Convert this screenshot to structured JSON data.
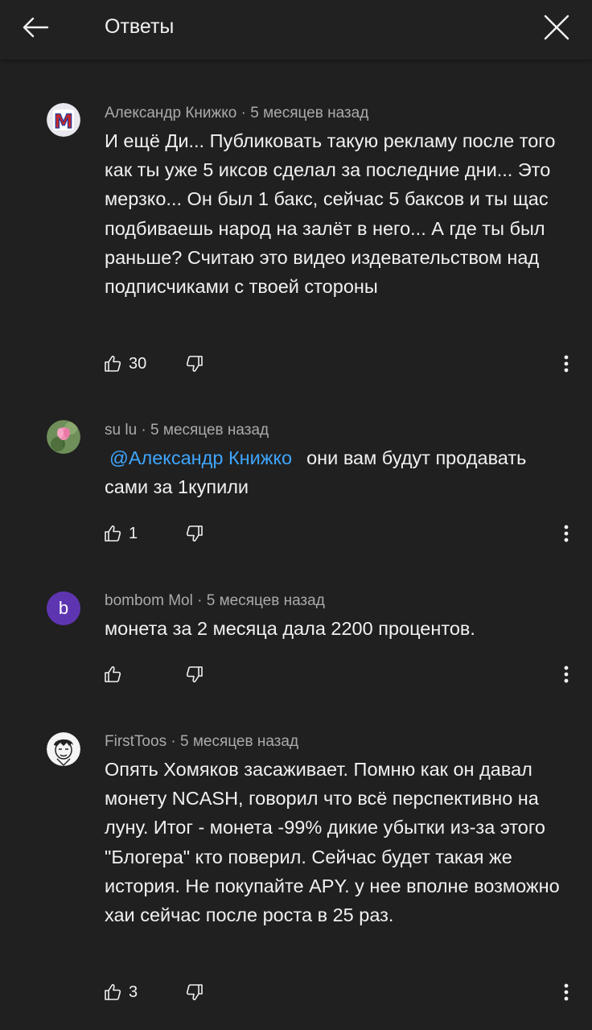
{
  "header": {
    "title": "Ответы"
  },
  "comments": [
    {
      "author": "Александр Книжко",
      "time": "5 месяцев назад",
      "text": "И ещё Ди... Публиковать такую рекламу после того как ты уже 5 иксов сделал за последние дни... Это мерзко... Он был 1 бакс, сейчас 5 баксов и ты щас подбиваешь народ на залёт в него... А где ты был раньше? Считаю это видео издевательством над подписчиками с твоей стороны",
      "likes": "30",
      "avatar_letter": "M"
    },
    {
      "author": "su lu",
      "time": "5 месяцев назад",
      "mention": "@Александр Книжко",
      "text": "они вам будут продавать сами за 1купили",
      "likes": "1"
    },
    {
      "author": "bombom Mol",
      "time": "5 месяцев назад",
      "text": "монета за 2 месяца дала 2200 процентов.",
      "likes": "",
      "avatar_letter": "b"
    },
    {
      "author": "FirstToos",
      "time": "5 месяцев назад",
      "text": "Опять Хомяков засаживает. Помню как он давал монету NCASH, говорил что всё перспективно на луну. Итог - монета -99% дикие убытки из-за этого \"Блогера\" кто поверил. Сейчас будет такая же история. Не покупайте APY. у нее вполне возможно хаи сейчас после роста в 25 раз.",
      "likes": "3"
    }
  ],
  "separator": " · ",
  "colors": {
    "background": "#202020",
    "text": "#f1f1f1",
    "secondary_text": "#aaaaaa",
    "mention": "#3ea6ff",
    "avatar_b": "#5e35b1"
  }
}
